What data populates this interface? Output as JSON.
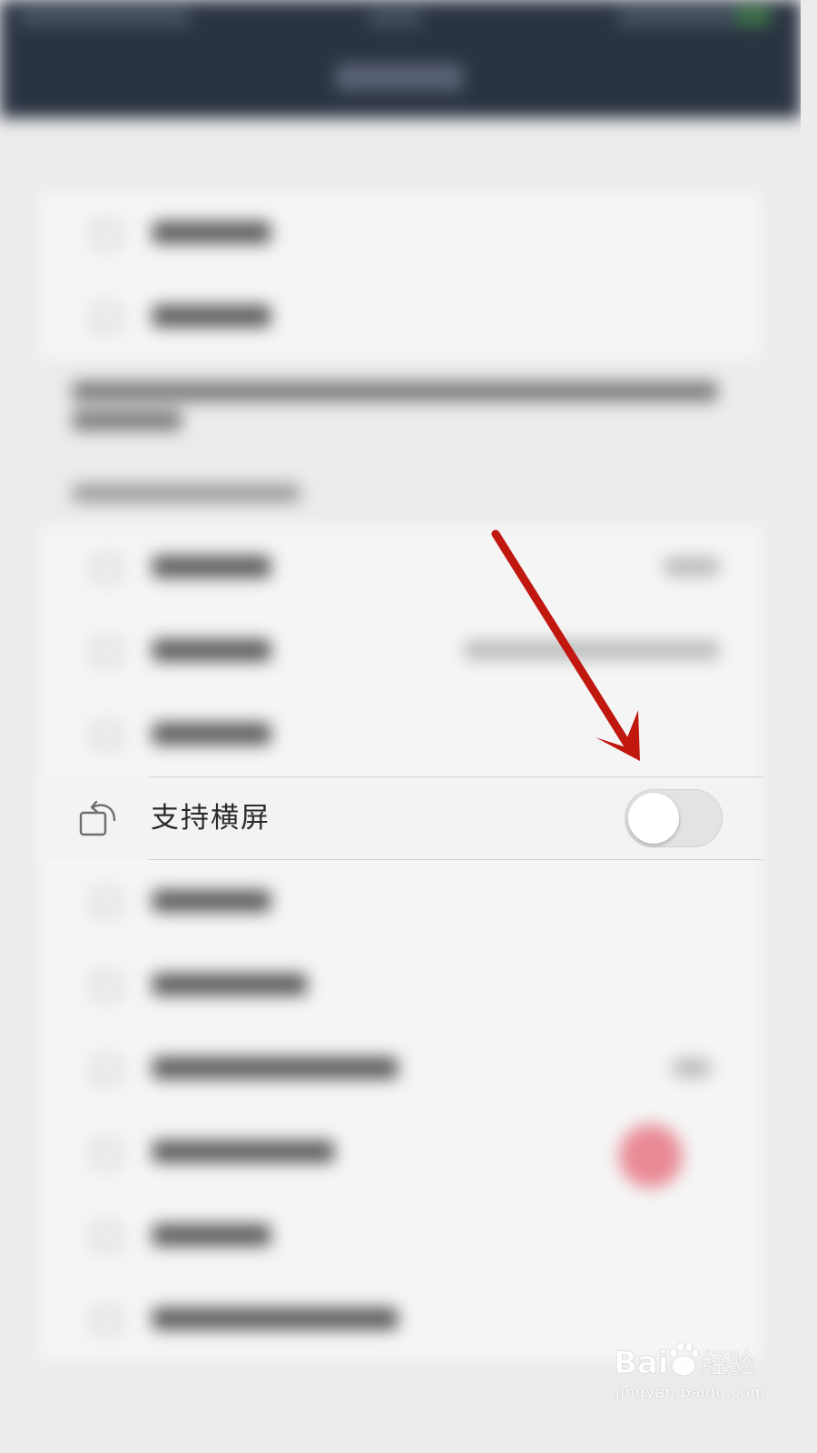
{
  "setting_row": {
    "label": "支持横屏",
    "icon": "rotate-screen-icon",
    "toggle_state": "off"
  },
  "annotation": {
    "arrow_color": "#c0170f"
  },
  "watermark": {
    "logo_text": "Baidu经验",
    "url": "jingyan.baidu.com"
  },
  "colors": {
    "header_bg": "#2a3342",
    "page_bg": "#ececec",
    "row_bg": "#f3f3f3",
    "toggle_off": "#e3e3e3"
  }
}
